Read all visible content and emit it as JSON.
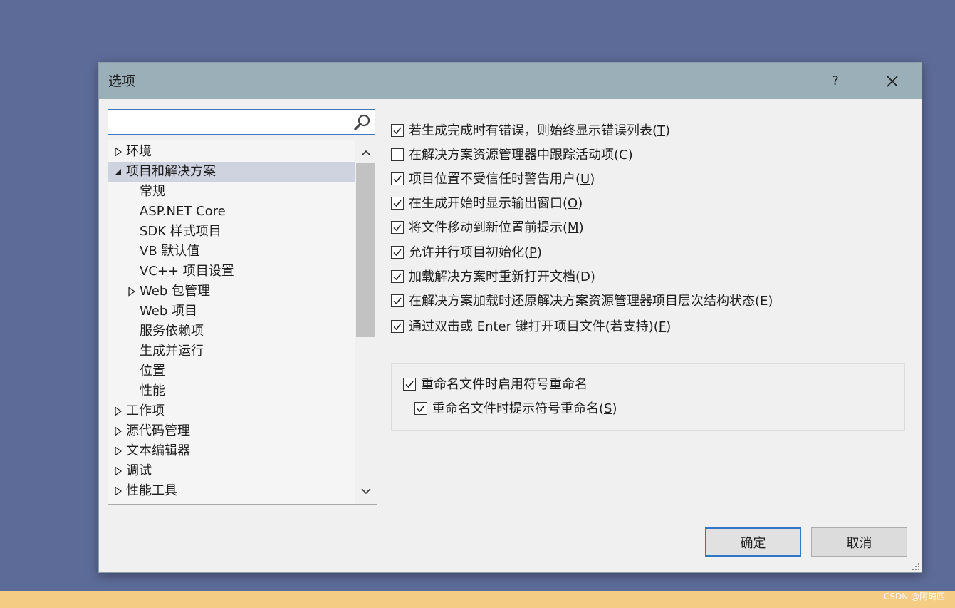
{
  "dialog": {
    "title": "选项",
    "help_label": "?"
  },
  "search": {
    "value": "",
    "placeholder": ""
  },
  "tree": [
    {
      "label": "环境",
      "level": 0,
      "caret": "collapsed",
      "selected": false
    },
    {
      "label": "项目和解决方案",
      "level": 0,
      "caret": "expanded",
      "selected": true
    },
    {
      "label": "常规",
      "level": 1,
      "caret": "none",
      "selected": false
    },
    {
      "label": "ASP.NET Core",
      "level": 1,
      "caret": "none",
      "selected": false
    },
    {
      "label": "SDK 样式项目",
      "level": 1,
      "caret": "none",
      "selected": false
    },
    {
      "label": "VB 默认值",
      "level": 1,
      "caret": "none",
      "selected": false
    },
    {
      "label": "VC++ 项目设置",
      "level": 1,
      "caret": "none",
      "selected": false
    },
    {
      "label": "Web 包管理",
      "level": 1,
      "caret": "collapsed",
      "selected": false
    },
    {
      "label": "Web 项目",
      "level": 1,
      "caret": "none",
      "selected": false
    },
    {
      "label": "服务依赖项",
      "level": 1,
      "caret": "none",
      "selected": false
    },
    {
      "label": "生成并运行",
      "level": 1,
      "caret": "none",
      "selected": false
    },
    {
      "label": "位置",
      "level": 1,
      "caret": "none",
      "selected": false
    },
    {
      "label": "性能",
      "level": 1,
      "caret": "none",
      "selected": false
    },
    {
      "label": "工作项",
      "level": 0,
      "caret": "collapsed",
      "selected": false
    },
    {
      "label": "源代码管理",
      "level": 0,
      "caret": "collapsed",
      "selected": false
    },
    {
      "label": "文本编辑器",
      "level": 0,
      "caret": "collapsed",
      "selected": false
    },
    {
      "label": "调试",
      "level": 0,
      "caret": "collapsed",
      "selected": false
    },
    {
      "label": "性能工具",
      "level": 0,
      "caret": "collapsed",
      "selected": false
    }
  ],
  "options": [
    {
      "text": "若生成完成时有错误，则始终显示错误列表(",
      "key": "T",
      "suffix": ")",
      "checked": true
    },
    {
      "text": "在解决方案资源管理器中跟踪活动项(",
      "key": "C",
      "suffix": ")",
      "checked": false
    },
    {
      "text": "项目位置不受信任时警告用户(",
      "key": "U",
      "suffix": ")",
      "checked": true
    },
    {
      "text": "在生成开始时显示输出窗口(",
      "key": "O",
      "suffix": ")",
      "checked": true
    },
    {
      "text": "将文件移动到新位置前提示(",
      "key": "M",
      "suffix": ")",
      "checked": true
    },
    {
      "text": "允许并行项目初始化(",
      "key": "P",
      "suffix": ")",
      "checked": true
    },
    {
      "text": "加载解决方案时重新打开文档(",
      "key": "D",
      "suffix": ")",
      "checked": true
    },
    {
      "text": "在解决方案加载时还原解决方案资源管理器项目层次结构状态(",
      "key": "E",
      "suffix": ")",
      "checked": true
    },
    {
      "text": "通过双击或 Enter 键打开项目文件(若支持)(",
      "key": "F",
      "suffix": ")",
      "checked": true
    }
  ],
  "rename_group": {
    "enable": {
      "text": "重命名文件时启用符号重命名",
      "key": "",
      "suffix": "",
      "checked": true
    },
    "prompt": {
      "text": "重命名文件时提示符号重命名(",
      "key": "S",
      "suffix": ")",
      "checked": true
    }
  },
  "buttons": {
    "ok": "确定",
    "cancel": "取消"
  },
  "watermark": "CSDN @阿琦匹",
  "colors": {
    "titlebar": "#9aafb7",
    "desktop": "#5d6b99",
    "accent": "#2e78c7"
  }
}
